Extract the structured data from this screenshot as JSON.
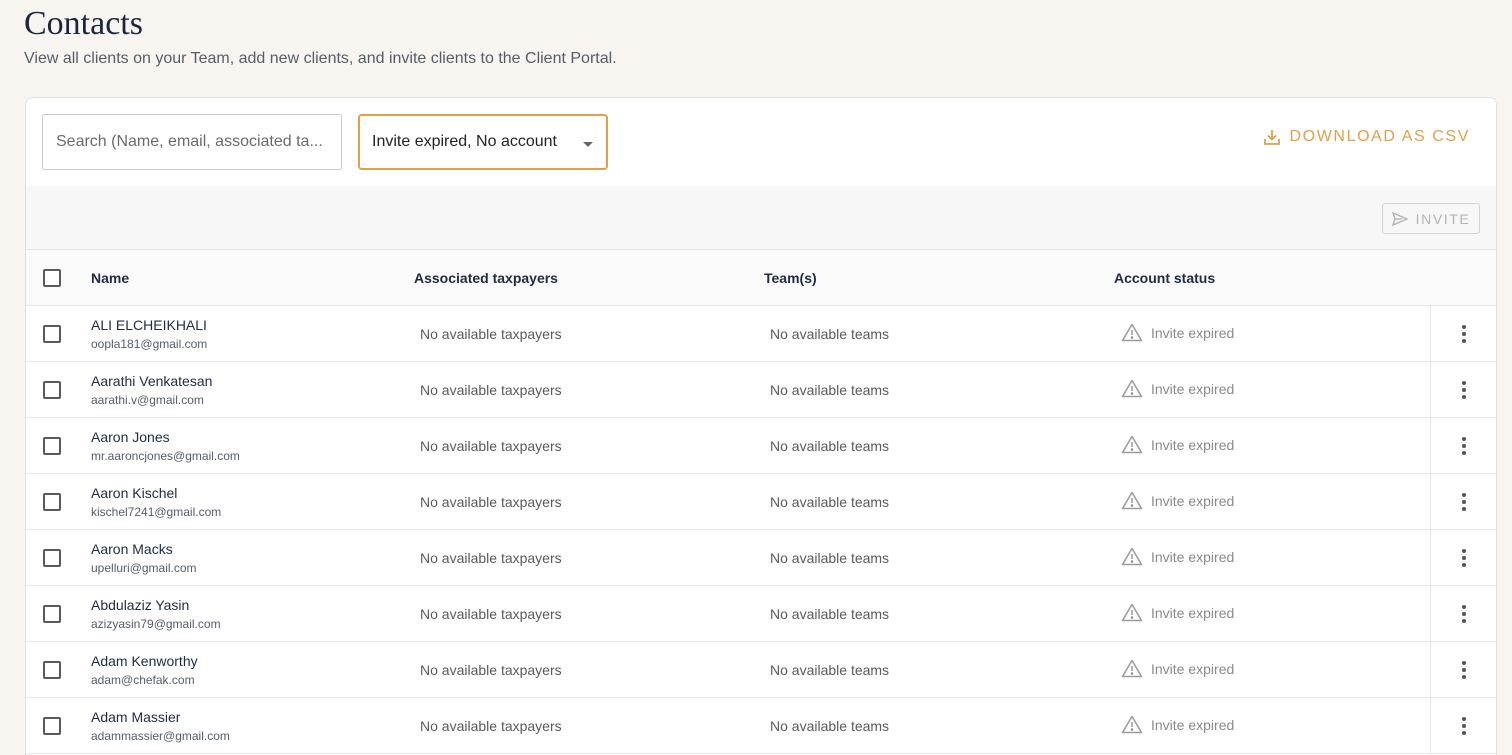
{
  "header": {
    "title": "Contacts",
    "subtitle": "View all clients on your Team, add new clients, and invite clients to the Client Portal."
  },
  "toolbar": {
    "search_placeholder": "Search (Name, email, associated ta...",
    "filter_value": "Invite expired, No account",
    "download_label": "DOWNLOAD AS CSV",
    "invite_label": "INVITE"
  },
  "colors": {
    "accent": "#e0a04a",
    "background": "#f8f4f0"
  },
  "table": {
    "columns": {
      "name": "Name",
      "taxpayers": "Associated taxpayers",
      "teams": "Team(s)",
      "status": "Account status"
    },
    "rows": [
      {
        "name": "ALI ELCHEIKHALI",
        "email": "oopla181@gmail.com",
        "taxpayers": "No available taxpayers",
        "teams": "No available teams",
        "status": "Invite expired"
      },
      {
        "name": "Aarathi Venkatesan",
        "email": "aarathi.v@gmail.com",
        "taxpayers": "No available taxpayers",
        "teams": "No available teams",
        "status": "Invite expired"
      },
      {
        "name": "Aaron Jones",
        "email": "mr.aaroncjones@gmail.com",
        "taxpayers": "No available taxpayers",
        "teams": "No available teams",
        "status": "Invite expired"
      },
      {
        "name": "Aaron Kischel",
        "email": "kischel7241@gmail.com",
        "taxpayers": "No available taxpayers",
        "teams": "No available teams",
        "status": "Invite expired"
      },
      {
        "name": "Aaron Macks",
        "email": "upelluri@gmail.com",
        "taxpayers": "No available taxpayers",
        "teams": "No available teams",
        "status": "Invite expired"
      },
      {
        "name": "Abdulaziz Yasin",
        "email": "azizyasin79@gmail.com",
        "taxpayers": "No available taxpayers",
        "teams": "No available teams",
        "status": "Invite expired"
      },
      {
        "name": "Adam Kenworthy",
        "email": "adam@chefak.com",
        "taxpayers": "No available taxpayers",
        "teams": "No available teams",
        "status": "Invite expired"
      },
      {
        "name": "Adam Massier",
        "email": "adammassier@gmail.com",
        "taxpayers": "No available taxpayers",
        "teams": "No available teams",
        "status": "Invite expired"
      }
    ]
  }
}
